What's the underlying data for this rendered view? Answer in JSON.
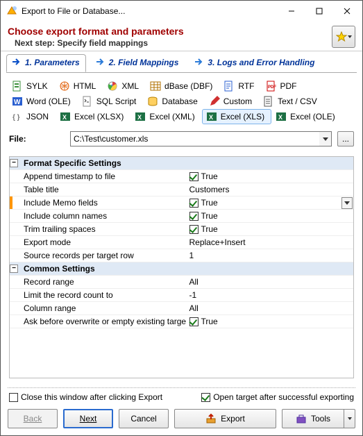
{
  "window": {
    "title": "Export to File or Database..."
  },
  "header": {
    "heading": "Choose export format and parameters",
    "next_step": "Next step: Specify field mappings"
  },
  "tabs": [
    {
      "label": "1. Parameters"
    },
    {
      "label": "2. Field Mappings"
    },
    {
      "label": "3. Logs and Error Handling"
    }
  ],
  "formats": {
    "sylk": "SYLK",
    "html": "HTML",
    "xml": "XML",
    "dbase": "dBase (DBF)",
    "rtf": "RTF",
    "pdf": "PDF",
    "word_ole": "Word (OLE)",
    "sql_script": "SQL Script",
    "database": "Database",
    "custom": "Custom",
    "text_csv": "Text / CSV",
    "json": "JSON",
    "excel_xlsx": "Excel (XLSX)",
    "excel_xml": "Excel (XML)",
    "excel_xls": "Excel (XLS)",
    "excel_ole": "Excel (OLE)"
  },
  "file": {
    "label": "File:",
    "value": "C:\\Test\\customer.xls",
    "browse": "..."
  },
  "grid": {
    "section1": "Format Specific Settings",
    "rows1": [
      {
        "name": "Append timestamp to file",
        "type": "check",
        "checked": true,
        "text": "True"
      },
      {
        "name": "Table title",
        "type": "text",
        "text": "Customers"
      },
      {
        "name": "Include Memo fields",
        "type": "check",
        "checked": true,
        "text": "True",
        "dropdown": true,
        "highlight": true
      },
      {
        "name": "Include column names",
        "type": "check",
        "checked": true,
        "text": "True"
      },
      {
        "name": "Trim trailing spaces",
        "type": "check",
        "checked": true,
        "text": "True"
      },
      {
        "name": "Export mode",
        "type": "text",
        "text": "Replace+Insert"
      },
      {
        "name": "Source records per target row",
        "type": "text",
        "text": "1"
      }
    ],
    "section2": "Common Settings",
    "rows2": [
      {
        "name": "Record range",
        "type": "text",
        "text": "All"
      },
      {
        "name": "Limit the record count to",
        "type": "text",
        "text": "-1"
      },
      {
        "name": "Column range",
        "type": "text",
        "text": "All"
      },
      {
        "name": "Ask before overwrite or empty existing targe",
        "type": "check",
        "checked": true,
        "text": "True"
      }
    ]
  },
  "bottom_checks": {
    "close_after": {
      "label": "Close this window after clicking Export",
      "checked": false
    },
    "open_target": {
      "label": "Open target after successful exporting",
      "checked": true
    }
  },
  "buttons": {
    "back": "Back",
    "next": "Next",
    "cancel": "Cancel",
    "export": "Export",
    "tools": "Tools"
  },
  "icons": {
    "arrow_color_active": "#0a50c8",
    "arrow_color": "#2b7bd9"
  }
}
